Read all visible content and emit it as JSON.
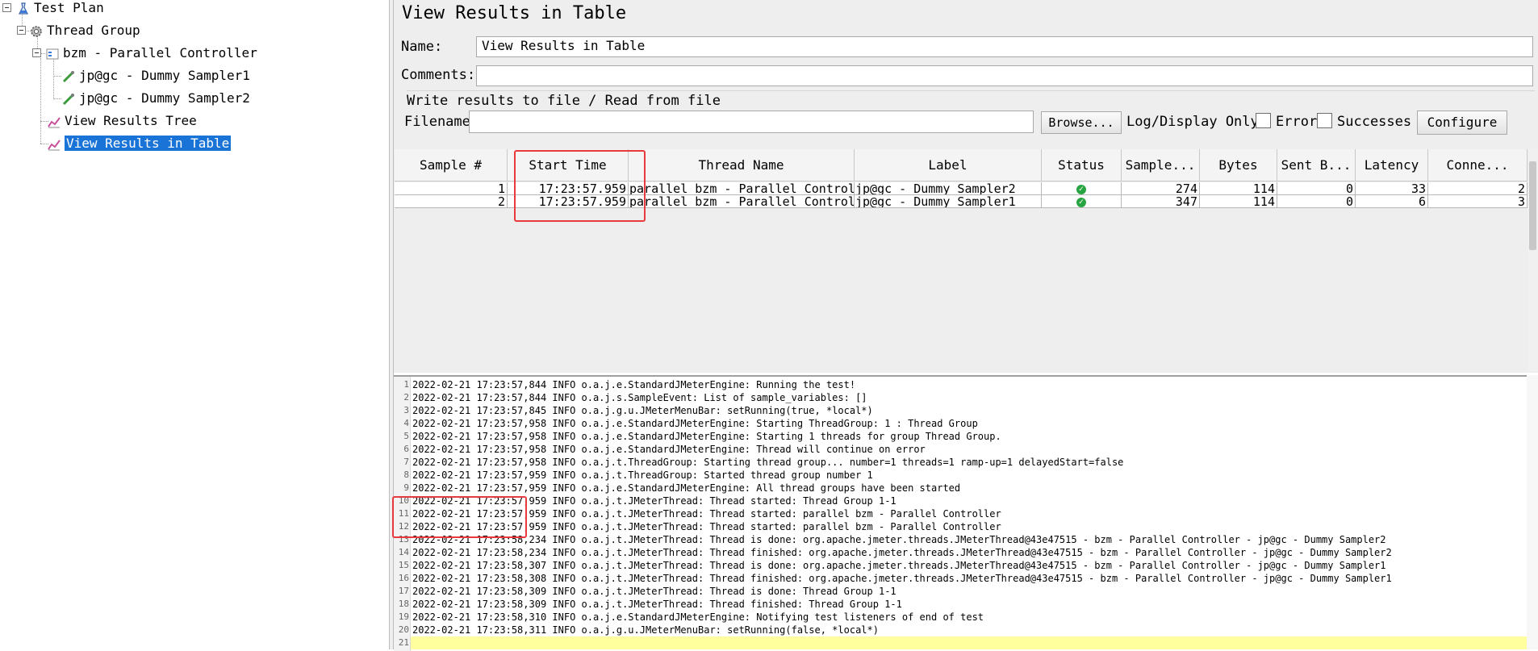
{
  "tree": {
    "items": [
      {
        "label": "Test Plan",
        "icon": "test-plan-icon"
      },
      {
        "label": "Thread Group",
        "icon": "gear-icon"
      },
      {
        "label": "bzm - Parallel Controller",
        "icon": "controller-icon"
      },
      {
        "label": "jp@gc - Dummy Sampler1",
        "icon": "sampler-icon"
      },
      {
        "label": "jp@gc - Dummy Sampler2",
        "icon": "sampler-icon"
      },
      {
        "label": "View Results Tree",
        "icon": "chart-icon"
      },
      {
        "label": "View Results in Table",
        "icon": "chart-icon",
        "selected": true
      }
    ]
  },
  "panel": {
    "title": "View Results in Table",
    "name_label": "Name:",
    "name_value": "View Results in Table",
    "comments_label": "Comments:",
    "comments_value": "",
    "file_group_title": "Write results to file / Read from file",
    "filename_label": "Filename",
    "filename_value": "",
    "browse_label": "Browse...",
    "log_display_label": "Log/Display Only:",
    "errors_label": "Errors",
    "successes_label": "Successes",
    "configure_label": "Configure"
  },
  "table": {
    "columns": [
      "Sample #",
      "Start Time",
      "Thread Name",
      "Label",
      "Status",
      "Sample...",
      "Bytes",
      "Sent B...",
      "Latency",
      "Conne..."
    ],
    "rows": [
      {
        "sample": "1",
        "start": "17:23:57.959",
        "thread": "parallel bzm - Parallel Controller",
        "label": "jp@gc - Dummy Sampler2",
        "status": "success",
        "sample_time": "274",
        "bytes": "114",
        "sent": "0",
        "latency": "33",
        "connect": "2"
      },
      {
        "sample": "2",
        "start": "17:23:57.959",
        "thread": "parallel bzm - Parallel Controller",
        "label": "jp@gc - Dummy Sampler1",
        "status": "success",
        "sample_time": "347",
        "bytes": "114",
        "sent": "0",
        "latency": "6",
        "connect": "3"
      }
    ]
  },
  "log": {
    "lines": [
      "2022-02-21 17:23:57,844 INFO o.a.j.e.StandardJMeterEngine: Running the test!",
      "2022-02-21 17:23:57,844 INFO o.a.j.s.SampleEvent: List of sample_variables: []",
      "2022-02-21 17:23:57,845 INFO o.a.j.g.u.JMeterMenuBar: setRunning(true, *local*)",
      "2022-02-21 17:23:57,958 INFO o.a.j.e.StandardJMeterEngine: Starting ThreadGroup: 1 : Thread Group",
      "2022-02-21 17:23:57,958 INFO o.a.j.e.StandardJMeterEngine: Starting 1 threads for group Thread Group.",
      "2022-02-21 17:23:57,958 INFO o.a.j.e.StandardJMeterEngine: Thread will continue on error",
      "2022-02-21 17:23:57,958 INFO o.a.j.t.ThreadGroup: Starting thread group... number=1 threads=1 ramp-up=1 delayedStart=false",
      "2022-02-21 17:23:57,959 INFO o.a.j.t.ThreadGroup: Started thread group number 1",
      "2022-02-21 17:23:57,959 INFO o.a.j.e.StandardJMeterEngine: All thread groups have been started",
      "2022-02-21 17:23:57,959 INFO o.a.j.t.JMeterThread: Thread started: Thread Group 1-1",
      "2022-02-21 17:23:57,959 INFO o.a.j.t.JMeterThread: Thread started: parallel bzm - Parallel Controller",
      "2022-02-21 17:23:57,959 INFO o.a.j.t.JMeterThread: Thread started: parallel bzm - Parallel Controller",
      "2022-02-21 17:23:58,234 INFO o.a.j.t.JMeterThread: Thread is done: org.apache.jmeter.threads.JMeterThread@43e47515 - bzm - Parallel Controller - jp@gc - Dummy Sampler2",
      "2022-02-21 17:23:58,234 INFO o.a.j.t.JMeterThread: Thread finished: org.apache.jmeter.threads.JMeterThread@43e47515 - bzm - Parallel Controller - jp@gc - Dummy Sampler2",
      "2022-02-21 17:23:58,307 INFO o.a.j.t.JMeterThread: Thread is done: org.apache.jmeter.threads.JMeterThread@43e47515 - bzm - Parallel Controller - jp@gc - Dummy Sampler1",
      "2022-02-21 17:23:58,308 INFO o.a.j.t.JMeterThread: Thread finished: org.apache.jmeter.threads.JMeterThread@43e47515 - bzm - Parallel Controller - jp@gc - Dummy Sampler1",
      "2022-02-21 17:23:58,309 INFO o.a.j.t.JMeterThread: Thread is done: Thread Group 1-1",
      "2022-02-21 17:23:58,309 INFO o.a.j.t.JMeterThread: Thread finished: Thread Group 1-1",
      "2022-02-21 17:23:58,310 INFO o.a.j.e.StandardJMeterEngine: Notifying test listeners of end of test",
      "2022-02-21 17:23:58,311 INFO o.a.j.g.u.JMeterMenuBar: setRunning(false, *local*)",
      ""
    ]
  },
  "colors": {
    "selection": "#1a73d6",
    "highlight_box": "#e8393c",
    "current_line": "#ffff9e",
    "status_ok": "#27a542"
  }
}
